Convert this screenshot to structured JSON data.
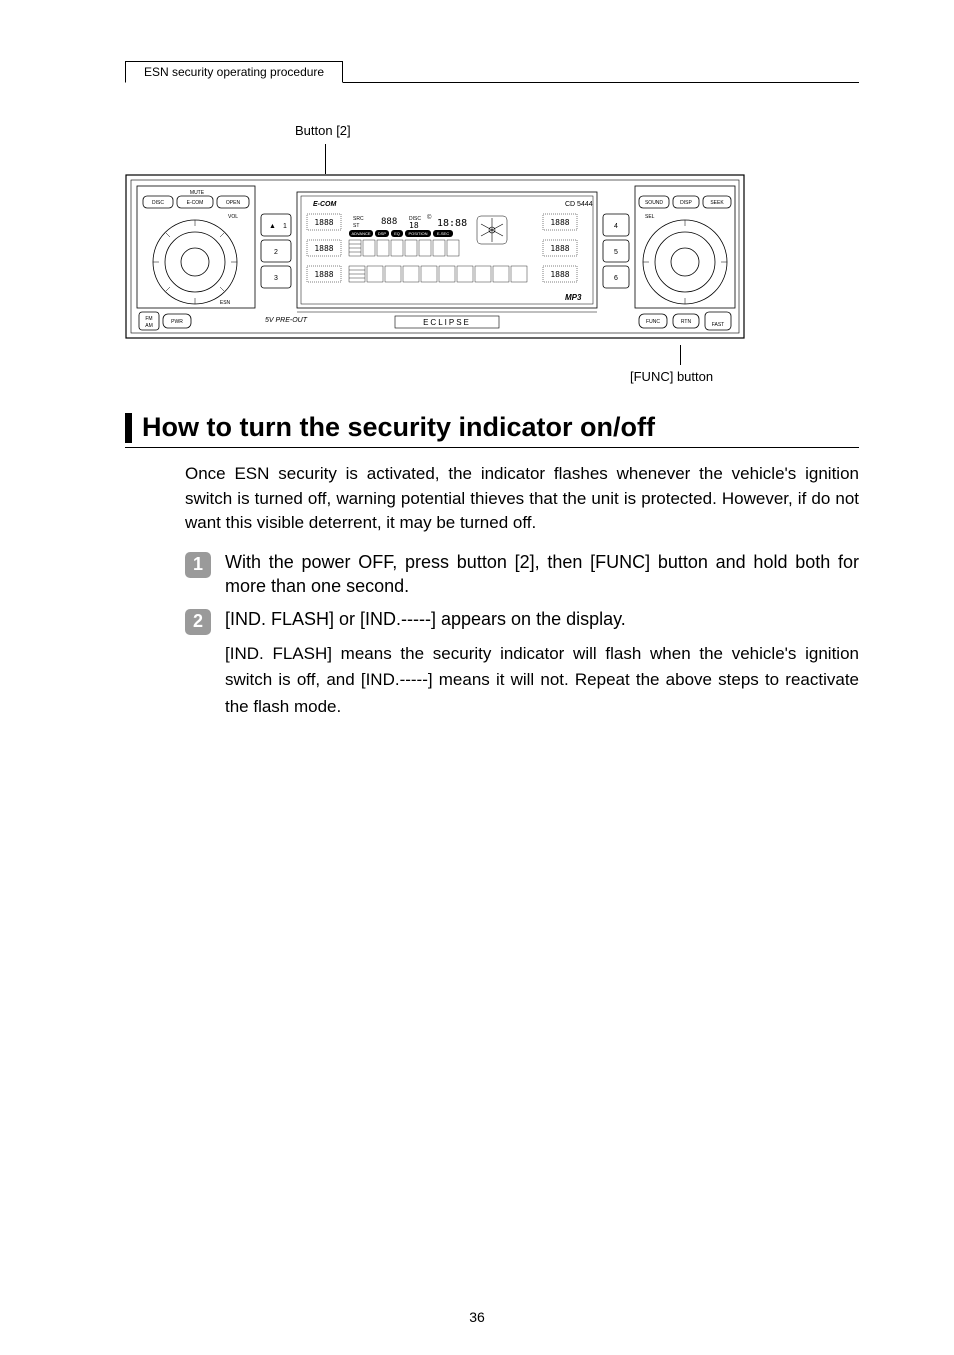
{
  "header": {
    "tab": "ESN security operating procedure"
  },
  "diagram": {
    "top_label": "Button [2]",
    "bottom_label": "[FUNC] button",
    "labels": {
      "mute": "MUTE",
      "disc": "DISC",
      "ecom": "E-COM",
      "open": "OPEN",
      "vol": "VOL",
      "esn": "ESN",
      "fm": "FM",
      "am": "AM",
      "pwr": "PWR",
      "preout": "5V PRE-OUT",
      "brand": "ECLIPSE",
      "ecom_logo": "E-COM",
      "model": "CD 5444",
      "mp3": "MP3",
      "sound": "SOUND",
      "disp": "DISP",
      "seek": "SEEK",
      "sel": "SEL",
      "func": "FUNC",
      "rtn": "RTN",
      "fast": "FAST",
      "src": "SRC",
      "st": "ST",
      "disc_ind": "DISC",
      "advance": "ADVANCE",
      "dsp": "DSP",
      "eq": "EQ",
      "position": "POSITION",
      "esec": "E-SEC",
      "clock": "18:88",
      "seg1": "1888",
      "seg2": "1888",
      "seg3": "1888",
      "seg4": "1888",
      "seg5": "1888",
      "seg6": "1888",
      "seg7": "888",
      "seg8": "18",
      "b1": "1",
      "b2": "2",
      "b3": "3",
      "b4": "4",
      "b5": "5",
      "b6": "6",
      "eject": "▲"
    }
  },
  "section": {
    "title": "How to turn the security indicator on/off"
  },
  "intro": "Once ESN security is activated, the indicator flashes whenever the vehicle's ignition switch is turned off, warning potential thieves that the unit is protected. However, if do not want this visible deterrent, it may be turned off.",
  "steps": [
    {
      "num": "1",
      "lead": "With the power OFF, press button [2], then [FUNC] button and hold both for more than one second."
    },
    {
      "num": "2",
      "lead": "[IND. FLASH] or [IND.-----] appears on the display.",
      "detail": "[IND. FLASH] means the security indicator will flash when the vehicle's ignition switch is off, and [IND.-----] means it will not. Repeat the above steps to reactivate the flash mode."
    }
  ],
  "page_number": "36"
}
